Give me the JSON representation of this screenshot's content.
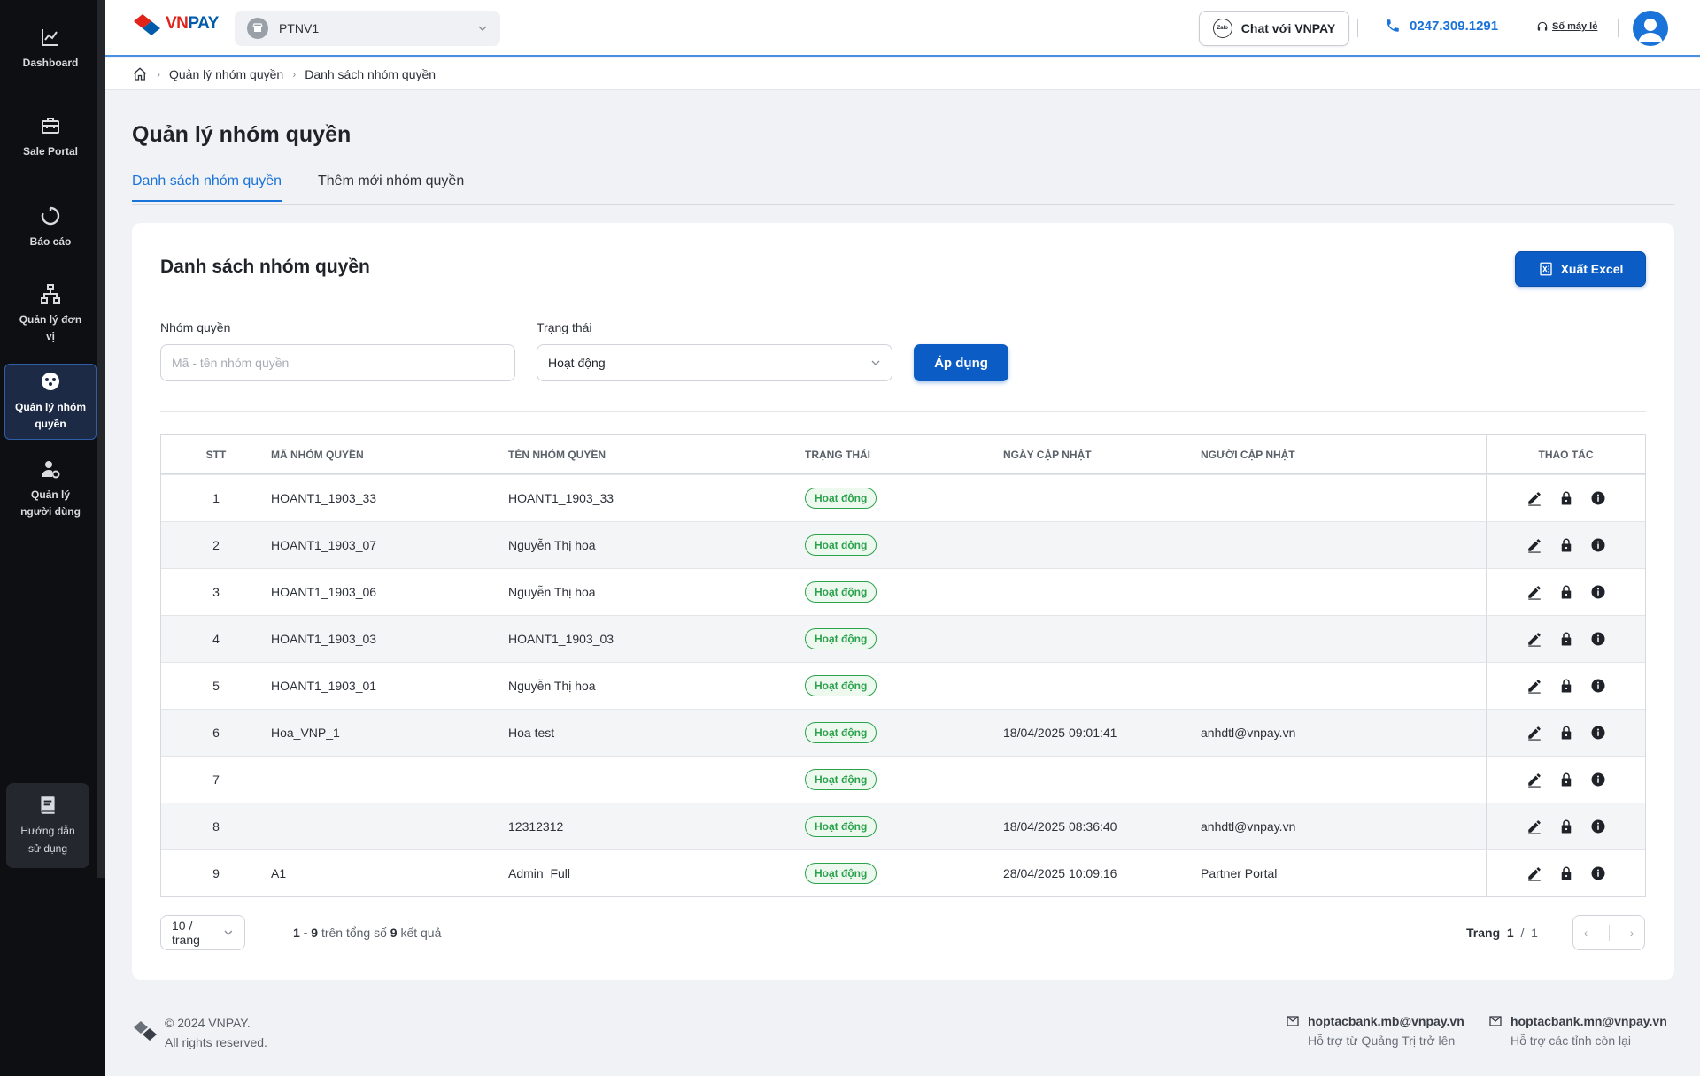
{
  "sidebar": {
    "items": [
      {
        "label": "Dashboard",
        "icon": "chart-line-icon"
      },
      {
        "label": "Sale Portal",
        "icon": "briefcase-icon"
      },
      {
        "label": "Báo cáo",
        "icon": "report-circle-icon"
      },
      {
        "label": "Quản lý đơn vị",
        "icon": "org-tree-icon"
      },
      {
        "label": "Quản lý nhóm quyền",
        "icon": "group-permission-icon",
        "active": true
      },
      {
        "label": "Quản lý người dùng",
        "icon": "user-gear-icon"
      }
    ],
    "guide": {
      "label": "Hướng dẫn sử dụng",
      "icon": "book-icon"
    }
  },
  "header": {
    "logo_text": "VNPAY",
    "merchant": "PTNV1",
    "chat_label": "Chat với VNPAY",
    "phone": "0247.309.1291",
    "landline_label": "Số máy lẻ",
    "accent": "#1a73d9"
  },
  "breadcrumb": [
    "Quản lý nhóm quyền",
    "Danh sách nhóm quyền"
  ],
  "page": {
    "title": "Quản lý nhóm quyền",
    "tabs": [
      {
        "label": "Danh sách nhóm quyền",
        "active": true
      },
      {
        "label": "Thêm mới nhóm quyền",
        "active": false
      }
    ]
  },
  "card": {
    "title": "Danh sách nhóm quyền",
    "excel_label": "Xuất Excel",
    "filters": {
      "group_label": "Nhóm quyền",
      "group_placeholder": "Mã - tên nhóm quyền",
      "status_label": "Trạng thái",
      "status_value": "Hoạt động",
      "apply_label": "Áp dụng"
    }
  },
  "table": {
    "columns": [
      "STT",
      "MÃ NHÓM QUYỀN",
      "TÊN NHÓM QUYỀN",
      "TRẠNG THÁI",
      "NGÀY CẬP NHẬT",
      "NGƯỜI CẬP NHẬT",
      "THAO TÁC"
    ],
    "rows": [
      {
        "stt": "1",
        "code": "HOANT1_1903_33",
        "name": "HOANT1_1903_33",
        "status": "Hoạt động",
        "date": "",
        "user": ""
      },
      {
        "stt": "2",
        "code": "HOANT1_1903_07",
        "name": "Nguyễn Thị hoa",
        "status": "Hoạt động",
        "date": "",
        "user": ""
      },
      {
        "stt": "3",
        "code": "HOANT1_1903_06",
        "name": "Nguyễn Thị hoa",
        "status": "Hoạt động",
        "date": "",
        "user": ""
      },
      {
        "stt": "4",
        "code": "HOANT1_1903_03",
        "name": "HOANT1_1903_03",
        "status": "Hoạt động",
        "date": "",
        "user": ""
      },
      {
        "stt": "5",
        "code": "HOANT1_1903_01",
        "name": "Nguyễn Thị hoa",
        "status": "Hoạt động",
        "date": "",
        "user": ""
      },
      {
        "stt": "6",
        "code": "Hoa_VNP_1",
        "name": "Hoa test",
        "status": "Hoạt động",
        "date": "18/04/2025 09:01:41",
        "user": "anhdtl@vnpay.vn"
      },
      {
        "stt": "7",
        "code": "",
        "name": "",
        "status": "Hoạt động",
        "date": "",
        "user": ""
      },
      {
        "stt": "8",
        "code": "",
        "name": "12312312",
        "status": "Hoạt động",
        "date": "18/04/2025 08:36:40",
        "user": "anhdtl@vnpay.vn"
      },
      {
        "stt": "9",
        "code": "A1",
        "name": "Admin_Full",
        "status": "Hoạt động",
        "date": "28/04/2025 10:09:16",
        "user": "Partner Portal"
      }
    ],
    "status_color": "#2ba24c"
  },
  "pagination": {
    "page_size": "10 / trang",
    "range_start": "1",
    "range_end": "9",
    "total": "9",
    "text_middle": "trên tổng số",
    "text_end": "kết quả",
    "page_label": "Trang",
    "current_page": "1",
    "total_pages": "1"
  },
  "footer": {
    "copyright": "© 2024 VNPAY.",
    "rights": "All rights reserved.",
    "contacts": [
      {
        "email": "hoptacbank.mb@vnpay.vn",
        "desc": "Hỗ trợ từ Quảng Trị trở lên"
      },
      {
        "email": "hoptacbank.mn@vnpay.vn",
        "desc": "Hỗ trợ các tỉnh còn lại"
      }
    ]
  }
}
